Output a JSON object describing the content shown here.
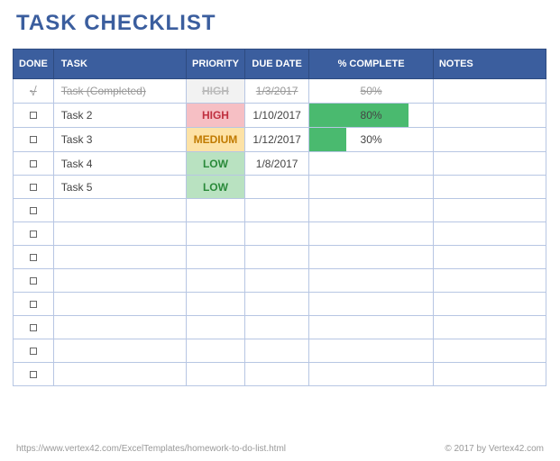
{
  "title": "TASK CHECKLIST",
  "headers": {
    "done": "DONE",
    "task": "TASK",
    "priority": "PRIORITY",
    "due": "DUE DATE",
    "pct": "% COMPLETE",
    "notes": "NOTES"
  },
  "rows": [
    {
      "done": true,
      "task": "Task (Completed)",
      "priority": "HIGH",
      "pri_class": "pri-high-done",
      "due": "1/3/2017",
      "pct": "50%",
      "pct_width": "50%",
      "strike": true
    },
    {
      "done": false,
      "task": "Task 2",
      "priority": "HIGH",
      "pri_class": "pri-high",
      "due": "1/10/2017",
      "pct": "80%",
      "pct_width": "80%",
      "strike": false
    },
    {
      "done": false,
      "task": "Task 3",
      "priority": "MEDIUM",
      "pri_class": "pri-med",
      "due": "1/12/2017",
      "pct": "30%",
      "pct_width": "30%",
      "strike": false
    },
    {
      "done": false,
      "task": "Task 4",
      "priority": "LOW",
      "pri_class": "pri-low",
      "due": "1/8/2017",
      "pct": "",
      "pct_width": "0%",
      "strike": false
    },
    {
      "done": false,
      "task": "Task 5",
      "priority": "LOW",
      "pri_class": "pri-low",
      "due": "",
      "pct": "",
      "pct_width": "0%",
      "strike": false
    },
    {
      "done": false,
      "task": "",
      "priority": "",
      "pri_class": "",
      "due": "",
      "pct": "",
      "pct_width": "0%",
      "strike": false
    },
    {
      "done": false,
      "task": "",
      "priority": "",
      "pri_class": "",
      "due": "",
      "pct": "",
      "pct_width": "0%",
      "strike": false
    },
    {
      "done": false,
      "task": "",
      "priority": "",
      "pri_class": "",
      "due": "",
      "pct": "",
      "pct_width": "0%",
      "strike": false
    },
    {
      "done": false,
      "task": "",
      "priority": "",
      "pri_class": "",
      "due": "",
      "pct": "",
      "pct_width": "0%",
      "strike": false
    },
    {
      "done": false,
      "task": "",
      "priority": "",
      "pri_class": "",
      "due": "",
      "pct": "",
      "pct_width": "0%",
      "strike": false
    },
    {
      "done": false,
      "task": "",
      "priority": "",
      "pri_class": "",
      "due": "",
      "pct": "",
      "pct_width": "0%",
      "strike": false
    },
    {
      "done": false,
      "task": "",
      "priority": "",
      "pri_class": "",
      "due": "",
      "pct": "",
      "pct_width": "0%",
      "strike": false
    },
    {
      "done": false,
      "task": "",
      "priority": "",
      "pri_class": "",
      "due": "",
      "pct": "",
      "pct_width": "0%",
      "strike": false
    }
  ],
  "footer": {
    "left": "https://www.vertex42.com/ExcelTemplates/homework-to-do-list.html",
    "right": "© 2017 by Vertex42.com"
  }
}
